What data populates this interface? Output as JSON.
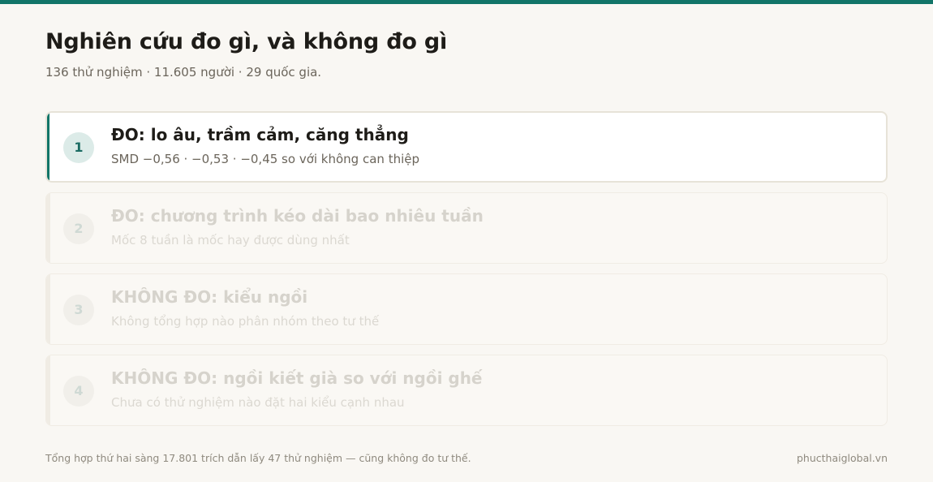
{
  "header": {
    "title": "Nghiên cứu đo gì, và không đo gì",
    "subtitle": "136 thử nghiệm · 11.605 người · 29 quốc gia."
  },
  "items": [
    {
      "number": "1",
      "title": "ĐO: lo âu, trầm cảm, căng thẳng",
      "subtitle": "SMD −0,56 · −0,53 · −0,45 so với không can thiệp",
      "active": true
    },
    {
      "number": "2",
      "title": "ĐO: chương trình kéo dài bao nhiêu tuần",
      "subtitle": "Mốc 8 tuần là mốc hay được dùng nhất",
      "active": false
    },
    {
      "number": "3",
      "title": "KHÔNG ĐO: kiểu ngồi",
      "subtitle": "Không tổng hợp nào phân nhóm theo tư thế",
      "active": false
    },
    {
      "number": "4",
      "title": "KHÔNG ĐO: ngồi kiết già so với ngồi ghế",
      "subtitle": "Chưa có thử nghiệm nào đặt hai kiểu cạnh nhau",
      "active": false
    }
  ],
  "footer": {
    "note": "Tổng hợp thứ hai sàng 17.801 trích dẫn lấy 47 thử nghiệm — cũng không đo tư thế.",
    "link": "phucthaiglobal.vn"
  },
  "colors": {
    "accent": "#127568",
    "background": "#f9f7f3"
  }
}
